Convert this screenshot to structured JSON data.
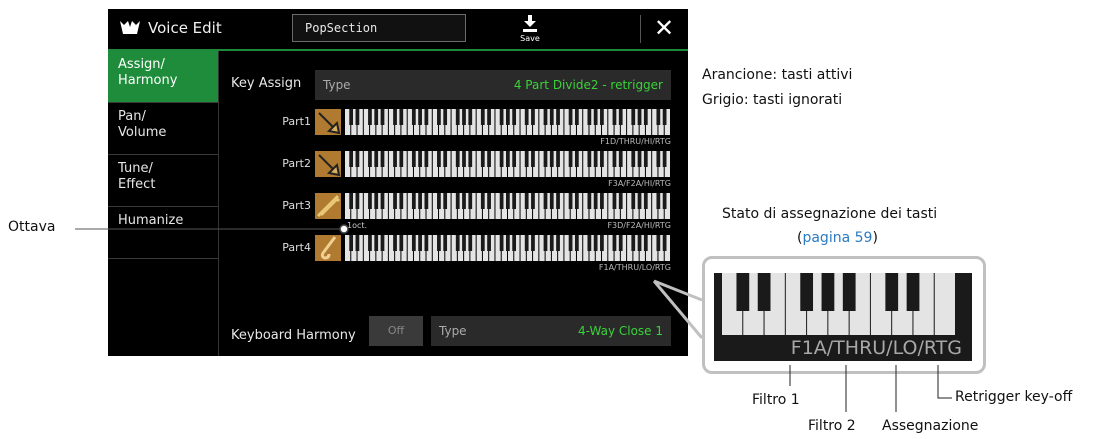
{
  "titlebar": {
    "title": "Voice Edit",
    "name_field": "PopSection",
    "save_label": "Save",
    "close_label": "✕"
  },
  "sidebar": {
    "tabs": [
      {
        "label": "Assign/\nHarmony",
        "active": true
      },
      {
        "label": "Pan/\nVolume",
        "active": false
      },
      {
        "label": "Tune/\nEffect",
        "active": false
      },
      {
        "label": "Humanize",
        "active": false
      }
    ]
  },
  "key_assign": {
    "label": "Key Assign",
    "type_label": "Type",
    "type_value": "4 Part Divide2 - retrigger"
  },
  "parts": [
    {
      "label": "Part1",
      "icon": "trumpet-icon",
      "setting": "F1D/THRU/HI/RTG"
    },
    {
      "label": "Part2",
      "icon": "trumpet-icon",
      "setting": "F3A/F2A/HI/RTG"
    },
    {
      "label": "Part3",
      "icon": "trombone-icon",
      "setting": "F3D/F2A/HI/RTG",
      "octave": "1oct."
    },
    {
      "label": "Part4",
      "icon": "saxophone-icon",
      "setting": "F1A/THRU/LO/RTG"
    }
  ],
  "keyboard_harmony": {
    "label": "Keyboard Harmony",
    "off_label": "Off",
    "type_label": "Type",
    "type_value": "4-Way Close 1"
  },
  "annotations": {
    "legend_orange": "Arancione: tasti attivi",
    "legend_grey": "Grigio: tasti ignorati",
    "status_title": "Stato di assegnazione dei tasti",
    "status_link_prefix": "(",
    "status_link": "pagina 59",
    "status_link_suffix": ")",
    "ottava": "Ottava",
    "zoom_text": "F1A/THRU/LO/RTG",
    "filtro1": "Filtro 1",
    "filtro2": "Filtro 2",
    "assegnazione": "Assegnazione",
    "retrigger": "Retrigger key-off"
  },
  "colors": {
    "accent_green": "#1e8c3a",
    "value_green": "#3ad23a",
    "link_blue": "#2a7ac0"
  }
}
